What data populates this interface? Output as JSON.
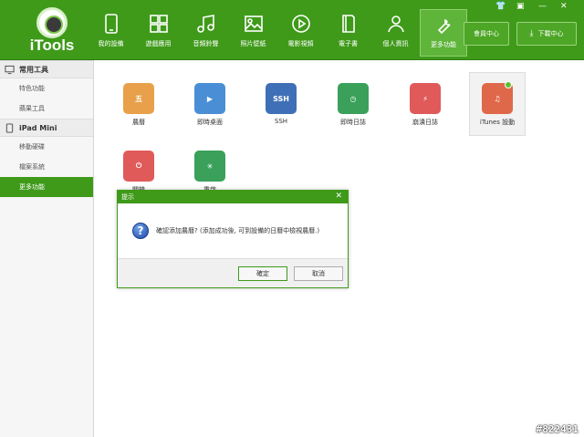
{
  "app": {
    "name": "iTools"
  },
  "nav": [
    {
      "label": "我的設備",
      "icon": "phone-icon"
    },
    {
      "label": "遊戲應用",
      "icon": "apps-icon"
    },
    {
      "label": "音頻鈴聲",
      "icon": "music-icon"
    },
    {
      "label": "照片壁紙",
      "icon": "photo-icon"
    },
    {
      "label": "電影視頻",
      "icon": "video-icon"
    },
    {
      "label": "電子書",
      "icon": "book-icon"
    },
    {
      "label": "個人資訊",
      "icon": "person-icon"
    },
    {
      "label": "更多功能",
      "icon": "wrench-icon",
      "active": true
    }
  ],
  "top_buttons": {
    "member": "會員中心",
    "download": "下載中心"
  },
  "sidebar": {
    "sections": [
      {
        "title": "常用工具",
        "icon": "monitor-icon",
        "items": [
          "特色功能",
          "蘋果工具"
        ]
      },
      {
        "title": "iPad Mini",
        "icon": "tablet-icon",
        "items": [
          "移動硬碟",
          "檔案系統",
          "更多功能"
        ]
      }
    ],
    "active_item": "更多功能"
  },
  "apps": [
    {
      "label": "農曆",
      "icon": "calendar-icon",
      "color": "#e8a04a",
      "glyph": "五"
    },
    {
      "label": "即時桌面",
      "icon": "live-desktop-icon",
      "color": "#4a8fd6",
      "glyph": "▶"
    },
    {
      "label": "SSH",
      "icon": "ssh-icon",
      "color": "#3f6fb6",
      "glyph": "SSH"
    },
    {
      "label": "即時日誌",
      "icon": "live-log-icon",
      "color": "#3aa05a",
      "glyph": "◷"
    },
    {
      "label": "崩潰日誌",
      "icon": "crash-log-icon",
      "color": "#e05a5a",
      "glyph": "⚡"
    },
    {
      "label": "iTunes 設動",
      "icon": "itunes-icon",
      "color": "#e0684a",
      "glyph": "♫"
    },
    {
      "label": "關機",
      "icon": "power-icon",
      "color": "#e05a5a",
      "glyph": "⏻"
    },
    {
      "label": "重啟",
      "icon": "restart-icon",
      "color": "#3aa05a",
      "glyph": "✳"
    }
  ],
  "dialog": {
    "title": "提示",
    "message": "確認添加農曆? (添加成功後, 可到設備的日曆中檢視農曆.)",
    "ok": "確定",
    "cancel": "取消"
  },
  "watermark": "#822431"
}
